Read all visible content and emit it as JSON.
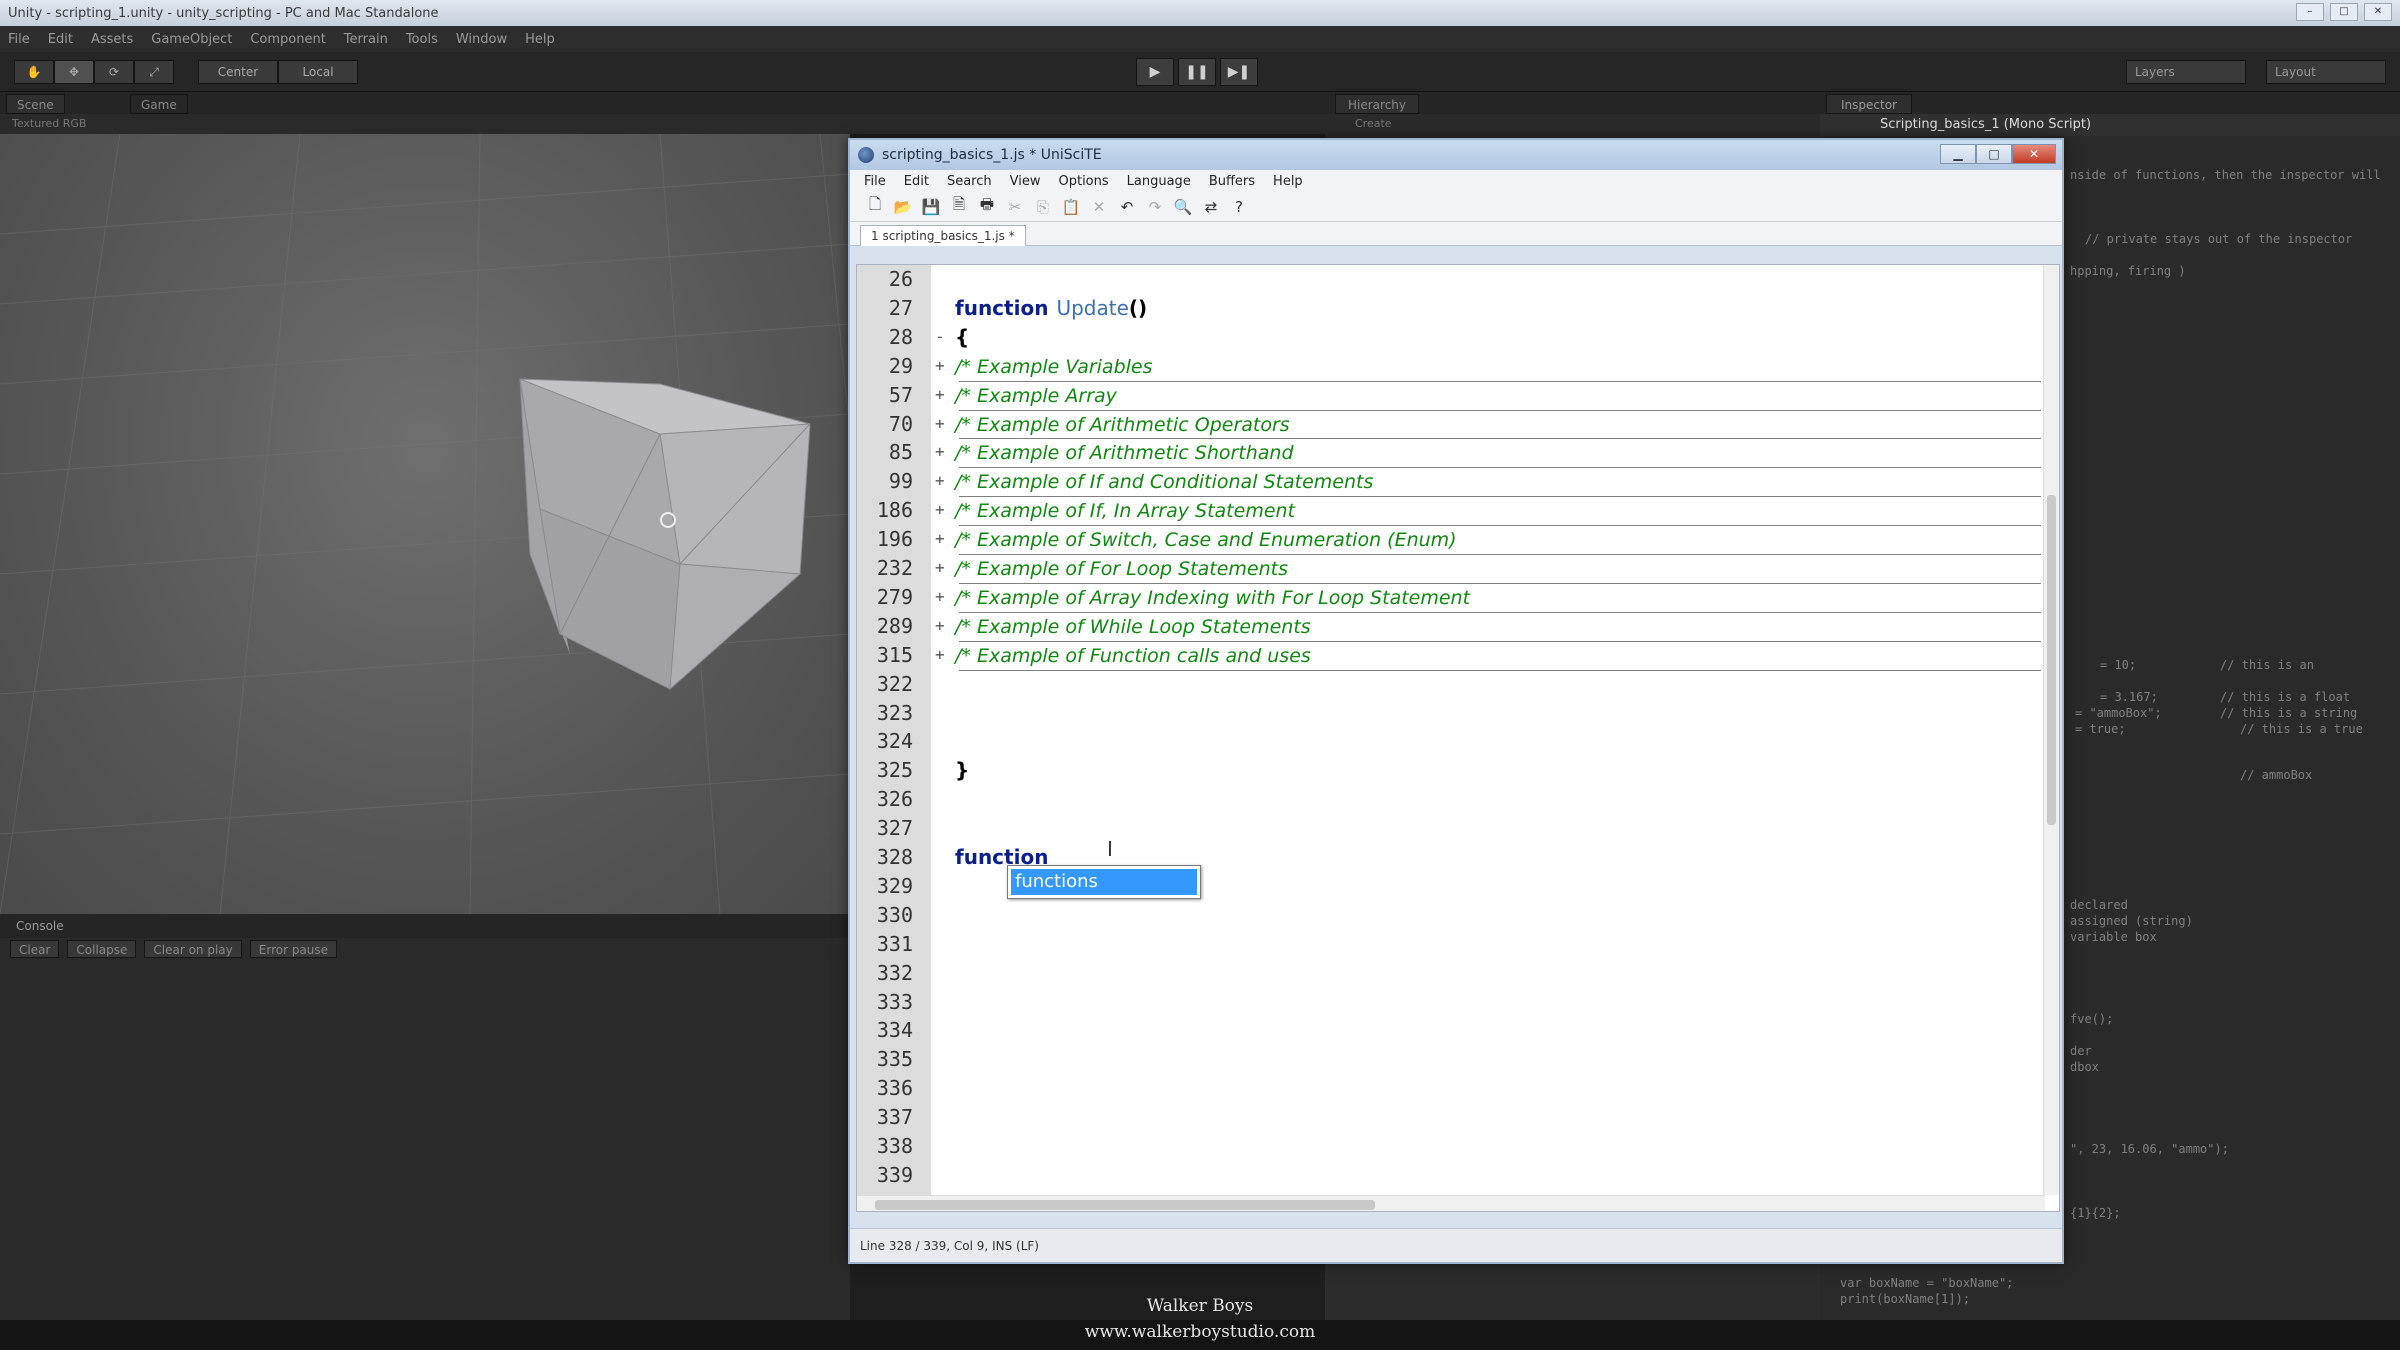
{
  "unity": {
    "title": "Unity - scripting_1.unity - unity_scripting - PC and Mac Standalone",
    "menu": [
      "File",
      "Edit",
      "Assets",
      "GameObject",
      "Component",
      "Terrain",
      "Tools",
      "Window",
      "Help"
    ],
    "toolbar": {
      "center_label": "Center",
      "local_label": "Local",
      "layers_label": "Layers",
      "layout_label": "Layout"
    },
    "scene": {
      "scene_tab": "Scene",
      "game_tab": "Game",
      "bar_text": "Textured   RGB"
    },
    "console": {
      "tab": "Console",
      "buttons": [
        "Clear",
        "Collapse",
        "Clear on play",
        "Error pause"
      ]
    },
    "hierarchy": {
      "tab": "Hierarchy",
      "create_label": "Create"
    },
    "inspector": {
      "tab": "Inspector",
      "header": "Scripting_basics_1 (Mono Script)",
      "lines": [
        "nside of functions, then the inspector will",
        "// private stays out of the inspector",
        "hpping, firing )",
        "= 10;",
        "// this is an",
        "= 3.167;",
        "// this is a float",
        "= \"ammoBox\";",
        "// this is a string",
        "= true;",
        "// this is a true",
        "// ammoBox",
        "declared",
        "assigned (string)",
        "variable box",
        "fve();",
        "der",
        "dbox",
        "\", 23, 16.06, \"ammo\");",
        "{1}{2};",
        "var boxName = \"boxName\";",
        "print(boxName[1]);"
      ]
    }
  },
  "editor": {
    "title": "scripting_basics_1.js * UniSciTE",
    "menu": [
      "File",
      "Edit",
      "Search",
      "View",
      "Options",
      "Language",
      "Buffers",
      "Help"
    ],
    "tab_label": "1 scripting_basics_1.js *",
    "status": "Line 328 / 339, Col 9, INS (LF)",
    "lines": [
      {
        "num": "26",
        "fold": "",
        "kw": "",
        "fn": "",
        "punc": "",
        "comment": ""
      },
      {
        "num": "27",
        "fold": "",
        "kw": "function",
        "fn": "Update",
        "punc": "()",
        "comment": ""
      },
      {
        "num": "28",
        "fold": "-",
        "kw": "",
        "fn": "",
        "punc": "{",
        "comment": ""
      },
      {
        "num": "29",
        "fold": "+",
        "kw": "",
        "fn": "",
        "punc": "",
        "comment": "/*  Example Variables"
      },
      {
        "num": "57",
        "fold": "+",
        "kw": "",
        "fn": "",
        "punc": "",
        "comment": "/*  Example Array"
      },
      {
        "num": "70",
        "fold": "+",
        "kw": "",
        "fn": "",
        "punc": "",
        "comment": "/*  Example of Arithmetic Operators"
      },
      {
        "num": "85",
        "fold": "+",
        "kw": "",
        "fn": "",
        "punc": "",
        "comment": "/*  Example of Arithmetic Shorthand"
      },
      {
        "num": "99",
        "fold": "+",
        "kw": "",
        "fn": "",
        "punc": "",
        "comment": "/*  Example of If and Conditional Statements"
      },
      {
        "num": "186",
        "fold": "+",
        "kw": "",
        "fn": "",
        "punc": "",
        "comment": "/*  Example of If, In Array Statement"
      },
      {
        "num": "196",
        "fold": "+",
        "kw": "",
        "fn": "",
        "punc": "",
        "comment": "/*  Example of Switch, Case and Enumeration (Enum)"
      },
      {
        "num": "232",
        "fold": "+",
        "kw": "",
        "fn": "",
        "punc": "",
        "comment": "/*  Example of For Loop Statements"
      },
      {
        "num": "279",
        "fold": "+",
        "kw": "",
        "fn": "",
        "punc": "",
        "comment": "/*  Example of Array Indexing with For Loop Statement"
      },
      {
        "num": "289",
        "fold": "+",
        "kw": "",
        "fn": "",
        "punc": "",
        "comment": "/*  Example of While Loop Statements"
      },
      {
        "num": "315",
        "fold": "+",
        "kw": "",
        "fn": "",
        "punc": "",
        "comment": "/* Example of Function calls and uses"
      },
      {
        "num": "322",
        "fold": "",
        "kw": "",
        "fn": "",
        "punc": "",
        "comment": ""
      },
      {
        "num": "323",
        "fold": "",
        "kw": "",
        "fn": "",
        "punc": "",
        "comment": ""
      },
      {
        "num": "324",
        "fold": "",
        "kw": "",
        "fn": "",
        "punc": "",
        "comment": ""
      },
      {
        "num": "325",
        "fold": "",
        "kw": "",
        "fn": "",
        "punc": "}",
        "comment": ""
      },
      {
        "num": "326",
        "fold": "",
        "kw": "",
        "fn": "",
        "punc": "",
        "comment": ""
      },
      {
        "num": "327",
        "fold": "",
        "kw": "",
        "fn": "",
        "punc": "",
        "comment": ""
      },
      {
        "num": "328",
        "fold": "",
        "kw": "function",
        "fn": "",
        "punc": "",
        "comment": ""
      },
      {
        "num": "329",
        "fold": "",
        "kw": "",
        "fn": "",
        "punc": "",
        "comment": ""
      },
      {
        "num": "330",
        "fold": "",
        "kw": "",
        "fn": "",
        "punc": "",
        "comment": ""
      },
      {
        "num": "331",
        "fold": "",
        "kw": "",
        "fn": "",
        "punc": "",
        "comment": ""
      },
      {
        "num": "332",
        "fold": "",
        "kw": "",
        "fn": "",
        "punc": "",
        "comment": ""
      },
      {
        "num": "333",
        "fold": "",
        "kw": "",
        "fn": "",
        "punc": "",
        "comment": ""
      },
      {
        "num": "334",
        "fold": "",
        "kw": "",
        "fn": "",
        "punc": "",
        "comment": ""
      },
      {
        "num": "335",
        "fold": "",
        "kw": "",
        "fn": "",
        "punc": "",
        "comment": ""
      },
      {
        "num": "336",
        "fold": "",
        "kw": "",
        "fn": "",
        "punc": "",
        "comment": ""
      },
      {
        "num": "337",
        "fold": "",
        "kw": "",
        "fn": "",
        "punc": "",
        "comment": ""
      },
      {
        "num": "338",
        "fold": "",
        "kw": "",
        "fn": "",
        "punc": "",
        "comment": ""
      },
      {
        "num": "339",
        "fold": "",
        "kw": "",
        "fn": "",
        "punc": "",
        "comment": ""
      }
    ],
    "autocomplete": [
      "functions"
    ]
  },
  "watermark": {
    "name": "Walker Boys",
    "url": "www.walkerboystudio.com"
  },
  "icons": {
    "play": "play-icon",
    "pause": "pause-icon",
    "step": "step-icon",
    "hand": "hand-tool-icon",
    "move": "move-tool-icon",
    "rotate": "rotate-tool-icon",
    "scale": "scale-tool-icon"
  }
}
